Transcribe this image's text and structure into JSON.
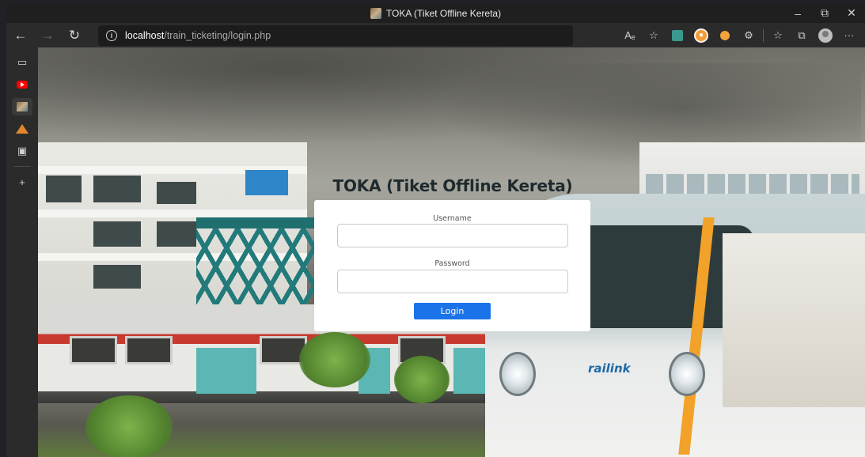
{
  "browser": {
    "window_title": "TOKA (Tiket Offline Kereta)",
    "url_host": "localhost",
    "url_path": "/train_ticketing/login.php",
    "window_controls": {
      "minimize": "–",
      "restore": "⧉",
      "close": "✕"
    },
    "nav": {
      "back": "←",
      "forward": "→",
      "refresh": "↻"
    },
    "toolbar_icons": [
      "read-aloud",
      "favorite-add",
      "extension-1",
      "extension-shield",
      "extension-2",
      "extensions",
      "favorites",
      "collections",
      "profile",
      "more"
    ],
    "toolbar_text": {
      "read_aloud": "Aₑ",
      "favorite": "☆",
      "extensions": "⚙",
      "favorites": "☆",
      "collections": "⧉",
      "more": "···"
    }
  },
  "sidebar": {
    "items": [
      "tab-actions",
      "youtube",
      "toka-tab",
      "triangle-app",
      "calendar"
    ],
    "add_label": "+",
    "icons": {
      "tab_actions": "▭",
      "calendar": "▣"
    }
  },
  "page": {
    "title": "TOKA (Tiket Offline Kereta)",
    "username_label": "Username",
    "username_value": "",
    "password_label": "Password",
    "password_value": "",
    "login_button": "Login",
    "logo_text": "railink"
  },
  "colors": {
    "button": "#1a73e8",
    "card": "#ffffff",
    "browser_dark": "#2b2b2b"
  }
}
